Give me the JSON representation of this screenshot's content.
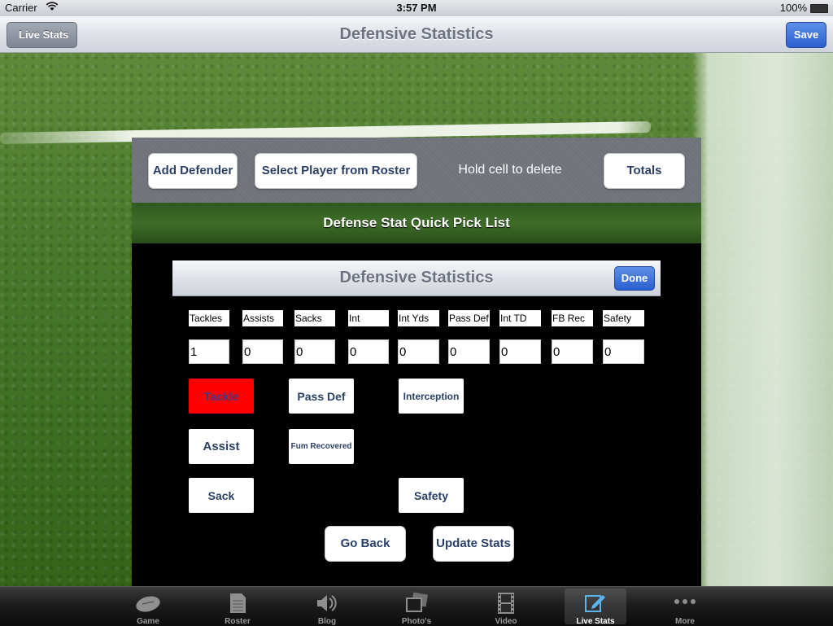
{
  "status_bar": {
    "carrier": "Carrier",
    "time": "3:57 PM",
    "battery": "100%"
  },
  "nav_bar": {
    "back_label": "Live Stats",
    "title": "Defensive Statistics",
    "save_label": "Save"
  },
  "toolbar": {
    "add_defender": "Add Defender",
    "select_player": "Select Player from Roster",
    "hold_hint": "Hold cell to delete",
    "totals": "Totals"
  },
  "quick_pick": {
    "title": "Defense Stat Quick Pick List"
  },
  "sub_nav": {
    "title": "Defensive Statistics",
    "done_label": "Done"
  },
  "stats": {
    "headers": [
      "Tackles",
      "Assists",
      "Sacks",
      "Int",
      "Int Yds",
      "Pass Def",
      "Int TD",
      "FB Rec",
      "Safety"
    ],
    "values": [
      "1",
      "0",
      "0",
      "0",
      "0",
      "0",
      "0",
      "0",
      "0"
    ]
  },
  "stat_buttons": {
    "tackle": "Tackle",
    "pass_def": "Pass Def",
    "interception": "Interception",
    "assist": "Assist",
    "fum_recovered": "Fum Recovered",
    "sack": "Sack",
    "safety": "Safety"
  },
  "actions": {
    "go_back": "Go Back",
    "update_stats": "Update Stats"
  },
  "tabs": [
    {
      "label": "Game",
      "icon": "football-icon"
    },
    {
      "label": "Roster",
      "icon": "document-icon"
    },
    {
      "label": "Blog",
      "icon": "speaker-icon"
    },
    {
      "label": "Photo's",
      "icon": "photos-icon"
    },
    {
      "label": "Video",
      "icon": "film-icon"
    },
    {
      "label": "Live Stats",
      "icon": "edit-icon",
      "active": true
    },
    {
      "label": "More",
      "icon": "more-icon"
    }
  ],
  "colors": {
    "accent_blue": "#2b5fcf",
    "tackle_active": "#ff0000",
    "button_text": "#2a3f66"
  }
}
